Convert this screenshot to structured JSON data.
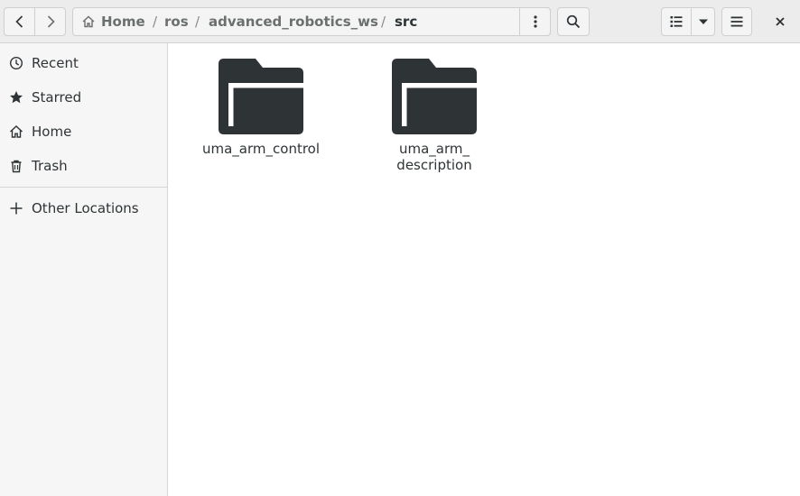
{
  "headerbar": {
    "breadcrumbs": [
      "Home",
      "ros",
      "advanced_robotics_ws",
      "src"
    ],
    "separator": "/"
  },
  "sidebar": {
    "items": [
      {
        "label": "Recent",
        "icon": "recent-clock-icon"
      },
      {
        "label": "Starred",
        "icon": "star-icon"
      },
      {
        "label": "Home",
        "icon": "home-icon"
      },
      {
        "label": "Trash",
        "icon": "trash-icon"
      }
    ],
    "other": {
      "label": "Other Locations",
      "icon": "plus-icon"
    }
  },
  "files": [
    {
      "name_line1": "uma_arm_control",
      "name_line2": "",
      "icon": "folder-icon"
    },
    {
      "name_line1": "uma_arm_",
      "name_line2": "description",
      "icon": "folder-icon"
    }
  ],
  "colors": {
    "folder": "#2e3436",
    "headerbar": "#ececec",
    "sidebar": "#f6f6f6"
  }
}
